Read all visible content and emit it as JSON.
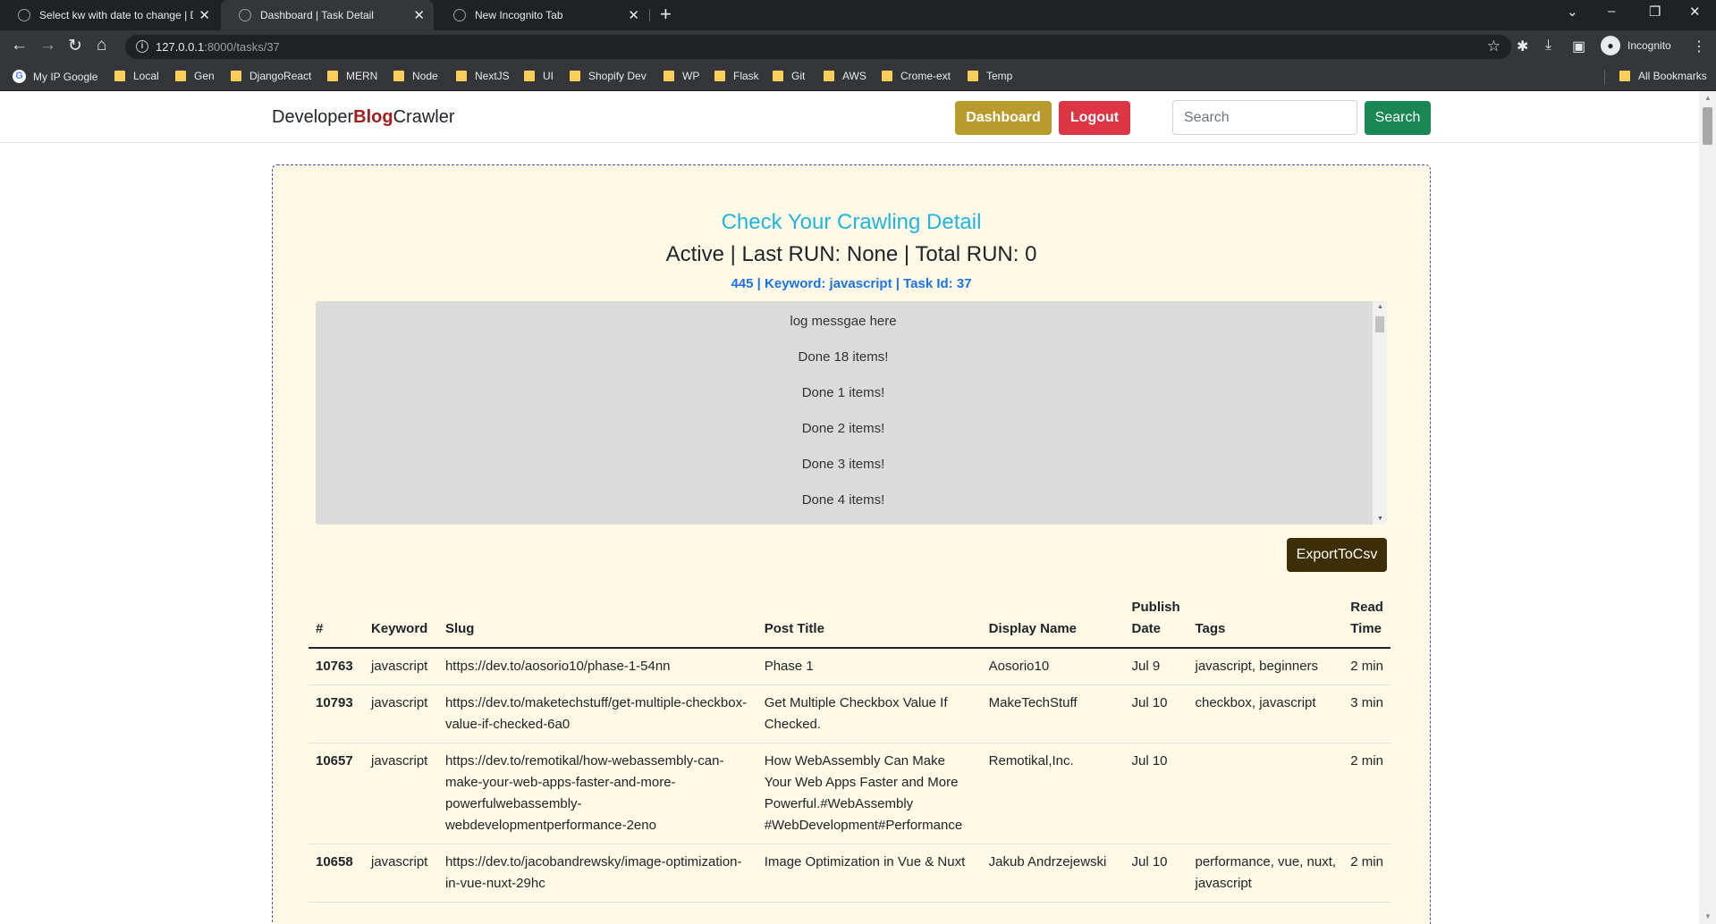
{
  "browser": {
    "tabs": [
      {
        "title": "Select kw with date to change | D",
        "active": false
      },
      {
        "title": "Dashboard | Task Detail",
        "active": true
      },
      {
        "title": "New Incognito Tab",
        "active": false
      }
    ],
    "url_host": "127.0.0.1",
    "url_rest": ":8000/tasks/37",
    "profile_label": "Incognito",
    "bookmarks": [
      "My IP Google",
      "Local",
      "Gen",
      "DjangoReact",
      "MERN",
      "Node",
      "NextJS",
      "UI",
      "Shopify Dev",
      "WP",
      "Flask",
      "Git",
      "AWS",
      "Crome-ext",
      "Temp"
    ],
    "all_bookmarks_label": "All Bookmarks"
  },
  "navbar": {
    "brand_part1": "Developer",
    "brand_part2": "Blog",
    "brand_part3": "Crawler",
    "dashboard_label": "Dashboard",
    "logout_label": "Logout",
    "search_placeholder": "Search",
    "search_button_label": "Search"
  },
  "detail": {
    "title": "Check Your Crawling Detail",
    "status_line": "Active | Last RUN: None | Total RUN: 0",
    "sub_line": "445 | Keyword: javascript | Task Id: 37",
    "log_lines": [
      "log messgae here",
      "Done 18 items!",
      "Done 1 items!",
      "Done 2 items!",
      "Done 3 items!",
      "Done 4 items!"
    ],
    "export_label": "ExportToCsv"
  },
  "table": {
    "headers": [
      "#",
      "Keyword",
      "Slug",
      "Post Title",
      "Display Name",
      "Publish Date",
      "Tags",
      "Read Time"
    ],
    "rows": [
      {
        "id": "10763",
        "keyword": "javascript",
        "slug": "https://dev.to/aosorio10/phase-1-54nn",
        "title": "Phase 1",
        "display_name": "Aosorio10",
        "date": "Jul 9",
        "tags": "javascript, beginners",
        "read_time": "2 min"
      },
      {
        "id": "10793",
        "keyword": "javascript",
        "slug": "https://dev.to/maketechstuff/get-multiple-checkbox-value-if-checked-6a0",
        "title": "Get Multiple Checkbox Value If Checked.",
        "display_name": "MakeTechStuff",
        "date": "Jul 10",
        "tags": "checkbox, javascript",
        "read_time": "3 min"
      },
      {
        "id": "10657",
        "keyword": "javascript",
        "slug": "https://dev.to/remotikal/how-webassembly-can-make-your-web-apps-faster-and-more-powerfulwebassembly-webdevelopmentperformance-2eno",
        "title": "How WebAssembly Can Make Your Web Apps Faster and More Powerful.#WebAssembly #WebDevelopment#Performance",
        "display_name": "Remotikal,Inc.",
        "date": "Jul 10",
        "tags": "",
        "read_time": "2 min"
      },
      {
        "id": "10658",
        "keyword": "javascript",
        "slug": "https://dev.to/jacobandrewsky/image-optimization-in-vue-nuxt-29hc",
        "title": "Image Optimization in Vue & Nuxt",
        "display_name": "Jakub Andrzejewski",
        "date": "Jul 10",
        "tags": "performance, vue, nuxt, javascript",
        "read_time": "2 min"
      }
    ]
  }
}
